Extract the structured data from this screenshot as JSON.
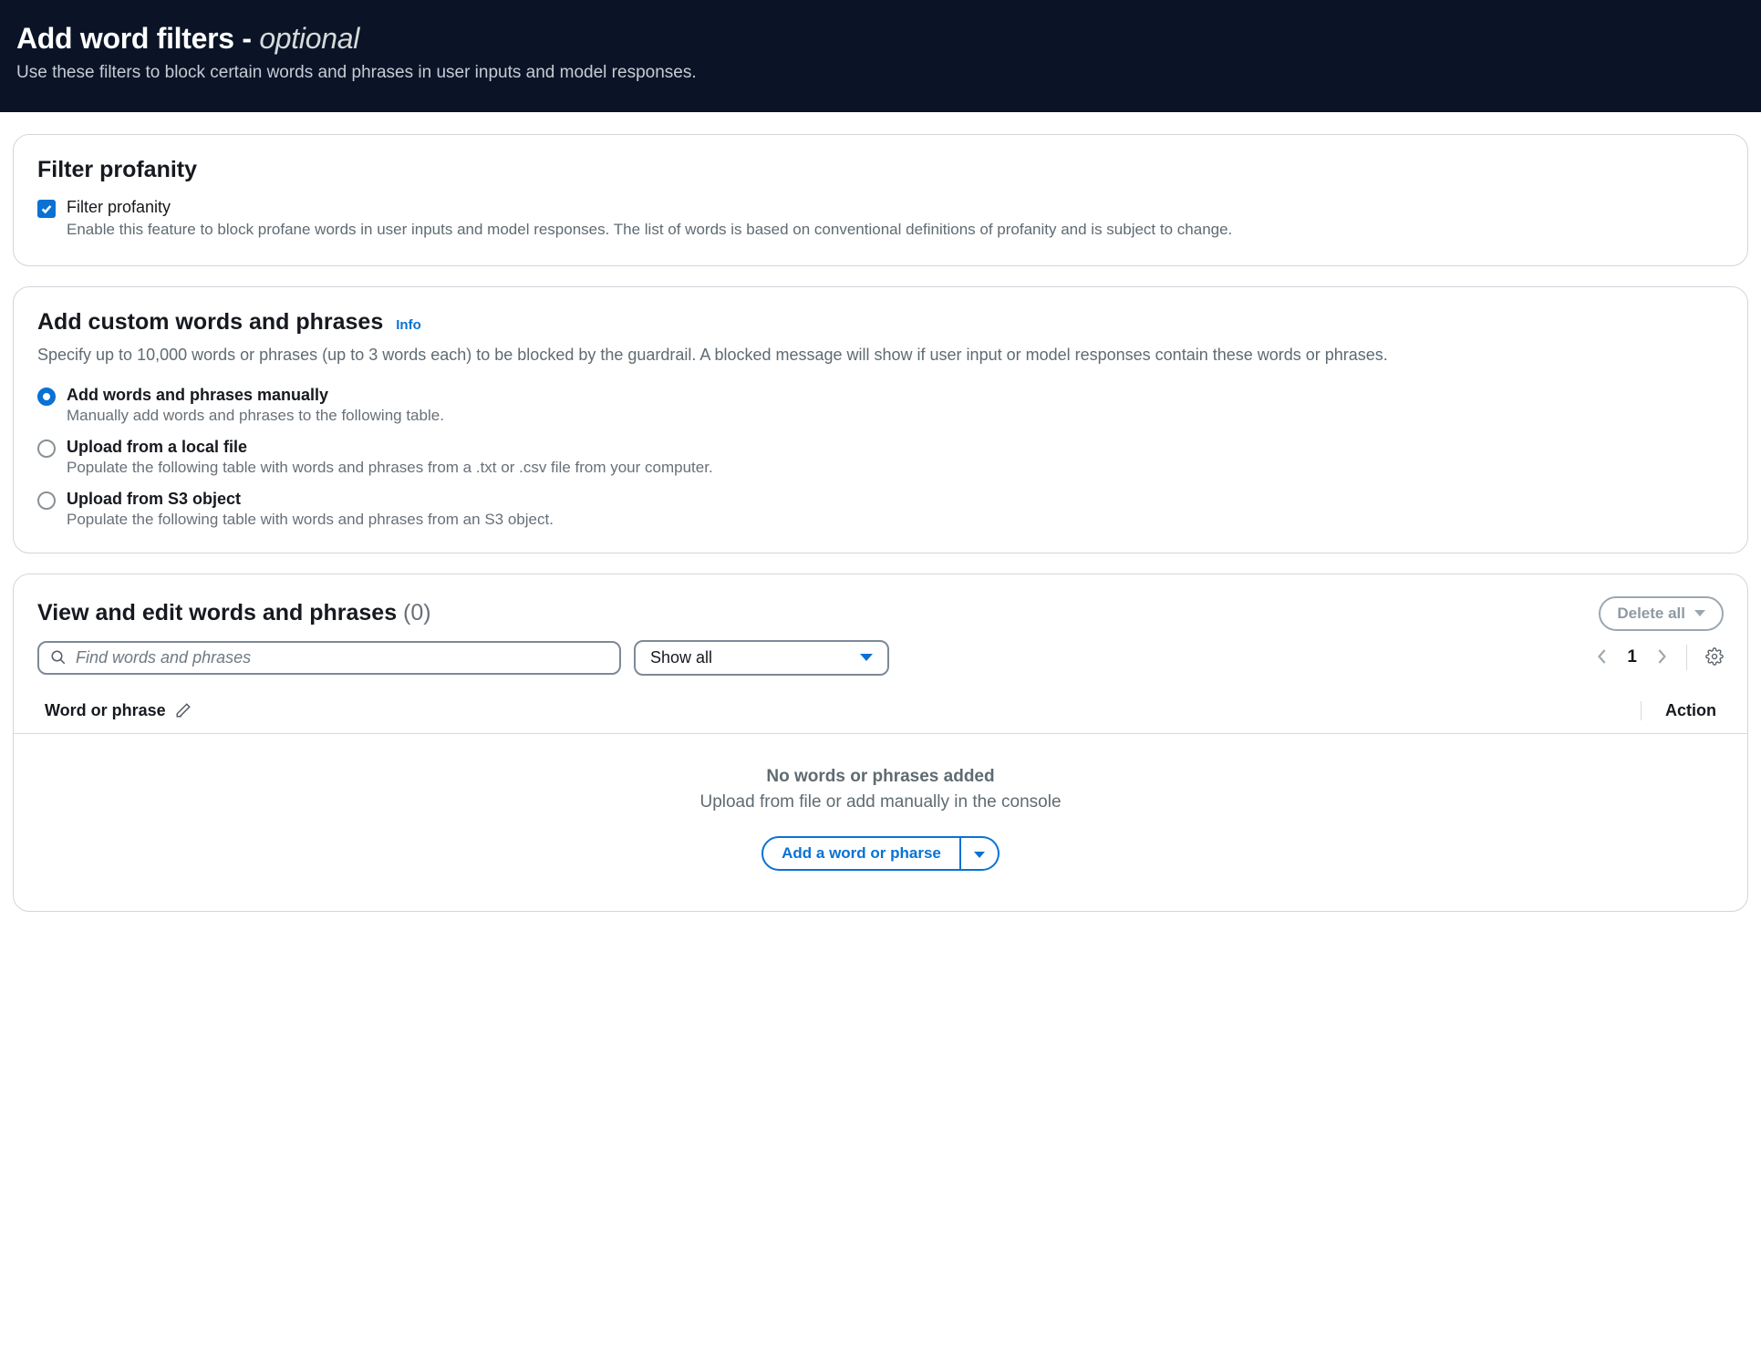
{
  "header": {
    "title_main": "Add word filters -",
    "title_optional": "optional",
    "subtitle": "Use these filters to block certain words and phrases in user inputs and model responses."
  },
  "profanity": {
    "heading": "Filter profanity",
    "checkbox_label": "Filter profanity",
    "checkbox_desc": "Enable this feature to block profane words in user inputs and model responses. The list of words is based on conventional definitions of profanity and is subject to change.",
    "checked": true
  },
  "custom": {
    "heading": "Add custom words and phrases",
    "info_label": "Info",
    "description": "Specify up to 10,000 words or phrases (up to 3 words each) to be blocked by the guardrail. A blocked message will show if user input or model responses contain these words or phrases.",
    "options": [
      {
        "label": "Add words and phrases manually",
        "desc": "Manually add words and phrases to the following table.",
        "selected": true
      },
      {
        "label": "Upload from a local file",
        "desc": "Populate the following table with words and phrases from a .txt or .csv file from your computer.",
        "selected": false
      },
      {
        "label": "Upload from S3 object",
        "desc": "Populate the following table with words and phrases from an S3 object.",
        "selected": false
      }
    ]
  },
  "view": {
    "heading": "View and edit words and phrases",
    "count_label": "(0)",
    "delete_all_label": "Delete all",
    "search_placeholder": "Find words and phrases",
    "select_value": "Show all",
    "page": "1",
    "col1_label": "Word or phrase",
    "col2_label": "Action",
    "empty_title": "No words or phrases added",
    "empty_sub": "Upload from file or add manually in the console",
    "add_button_label": "Add a word or pharse"
  }
}
